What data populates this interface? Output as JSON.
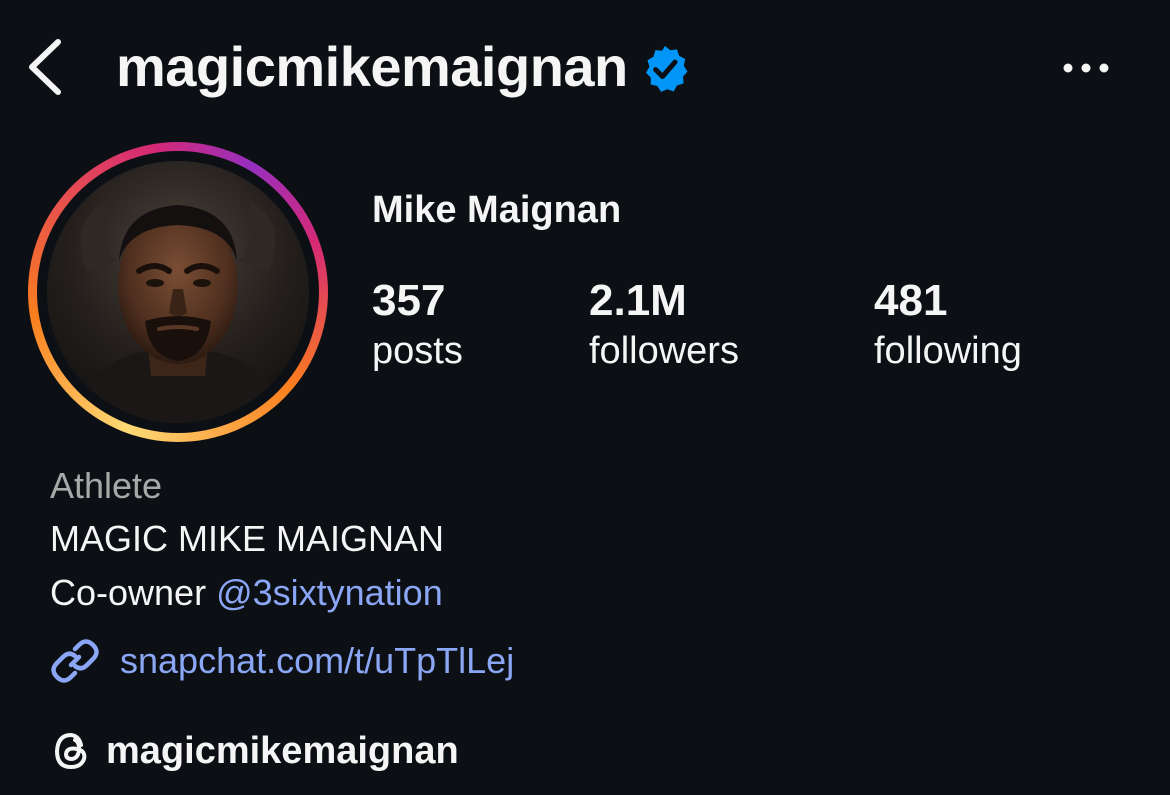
{
  "header": {
    "back_icon": "chevron-left-icon",
    "username": "magicmikemaignan",
    "verified_icon": "verified-badge-icon",
    "more_icon": "more-horizontal-icon"
  },
  "profile": {
    "avatar_ring_colors": [
      "#feda75",
      "#fa7e1e",
      "#d62976",
      "#962fbf"
    ],
    "display_name": "Mike Maignan",
    "stats": [
      {
        "value": "357",
        "label": "posts"
      },
      {
        "value": "2.1M",
        "label": "followers"
      },
      {
        "value": "481",
        "label": "following"
      }
    ]
  },
  "bio": {
    "category": "Athlete",
    "line1": "MAGIC MIKE MAIGNAN",
    "line2_prefix": "Co-owner ",
    "line2_mention": "@3sixtynation",
    "link_icon": "link-icon",
    "link": "snapchat.com/t/uTpTlLej",
    "threads_icon": "threads-icon",
    "threads_handle": "magicmikemaignan"
  },
  "colors": {
    "background": "#0c1014",
    "text": "#f5f5f5",
    "muted": "#a8a8a8",
    "link": "#8aa6f5",
    "verified": "#0095f6"
  }
}
